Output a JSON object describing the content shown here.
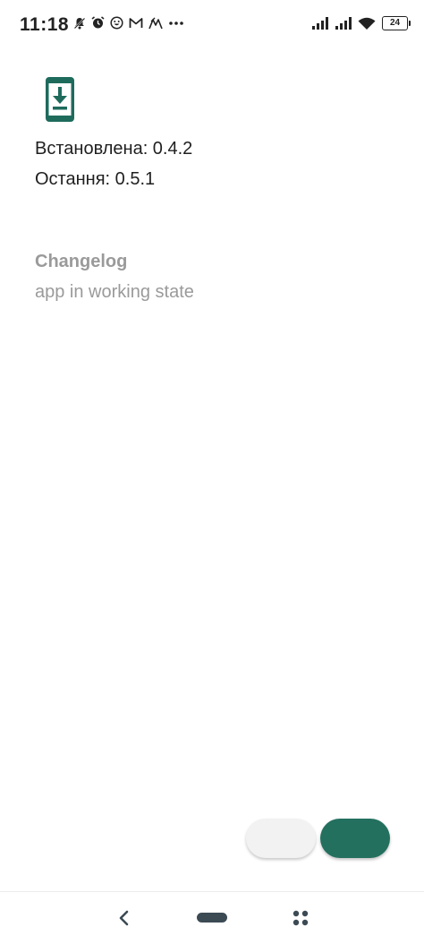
{
  "status_bar": {
    "time": "11:18",
    "battery_level": "24",
    "left_icons": [
      "notification-muted-icon",
      "alarm-icon",
      "emoji-icon",
      "gmail-icon",
      "signal-app-icon",
      "more-dots-icon"
    ],
    "right_icons": [
      "signal-bars-icon",
      "signal-bars-icon",
      "wifi-icon",
      "battery-icon"
    ]
  },
  "app_info": {
    "icon": "phone-download-icon",
    "installed_label": "Встановлена: 0.4.2",
    "latest_label": "Остання: 0.5.1"
  },
  "changelog": {
    "title": "Changelog",
    "text": "app in working state"
  },
  "colors": {
    "accent": "#23705f",
    "icon_color": "#1e6b5c",
    "muted_text": "#9a9a9a"
  },
  "nav_bar": {
    "icons": [
      "back-icon",
      "home-pill-icon",
      "app-switcher-icon"
    ]
  }
}
